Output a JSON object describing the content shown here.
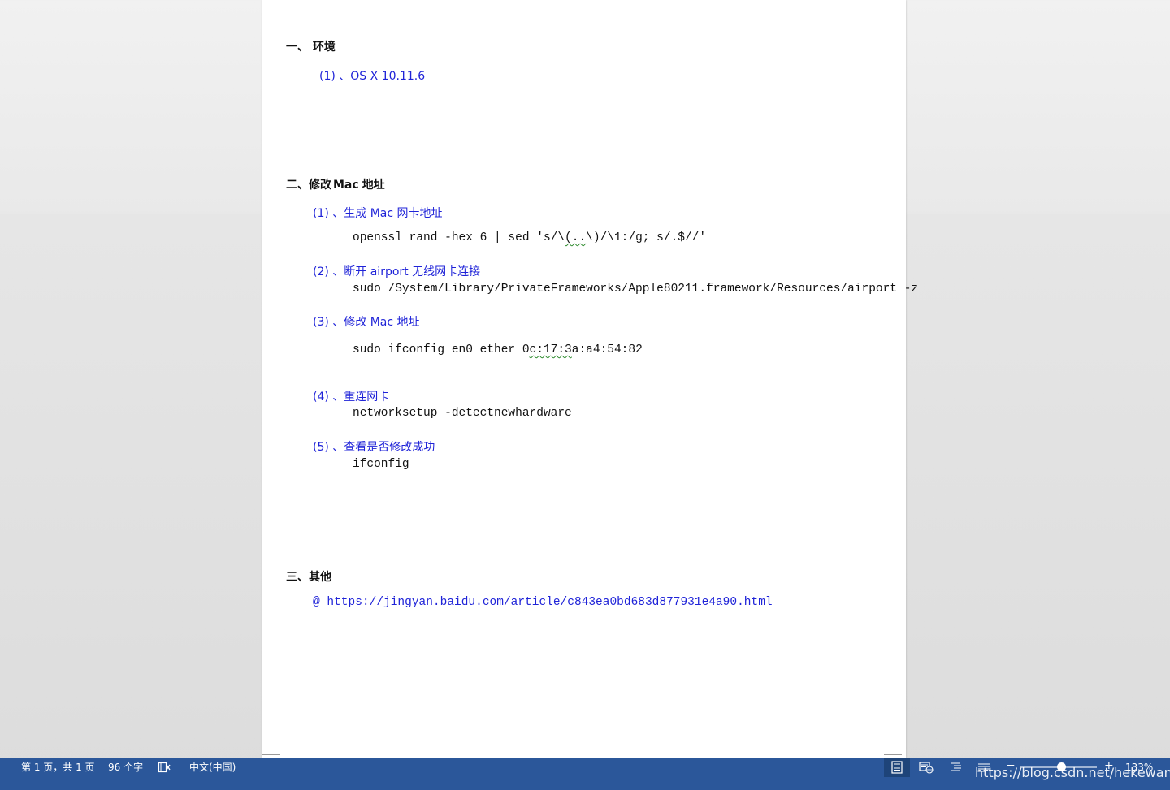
{
  "document": {
    "section1": {
      "heading": "一、 环境",
      "item1": "(1) 、OS X 10.11.6"
    },
    "section2": {
      "heading_prefix": "二、修改",
      "heading_mac": "Mac",
      "heading_suffix": "地址",
      "step1_title": "(1) 、生成 Mac 网卡地址",
      "step1_cmd_a": "openssl rand -hex 6 | sed 's/\\",
      "step1_cmd_sq": "(..",
      "step1_cmd_b": "\\)/\\1:/g; s/.$//'",
      "step2_title": "(2) 、断开 airport 无线网卡连接",
      "step2_cmd": "sudo /System/Library/PrivateFrameworks/Apple80211.framework/Resources/airport -z",
      "step3_title": "(3) 、修改 Mac 地址",
      "step3_cmd_a": "sudo ifconfig en0 ether 0",
      "step3_cmd_sq": "c:17:3",
      "step3_cmd_b": "a:a4:54:82",
      "step4_title": "(4) 、重连网卡",
      "step4_cmd": "networksetup -detectnewhardware",
      "step5_title": "(5) 、查看是否修改成功",
      "step5_cmd": "ifconfig"
    },
    "section3": {
      "heading": "三、其他",
      "link": "@ https://jingyan.baidu.com/article/c843ea0bd683d877931e4a90.html"
    }
  },
  "statusbar": {
    "page_info": "第 1 页，共 1 页",
    "word_count": "96 个字",
    "proofing_icon": "proofing-book-icon",
    "language": "中文(中国)",
    "zoom": "133%",
    "zoom_minus": "−",
    "zoom_plus": "+"
  },
  "watermark": "https://blog.csdn.net/hekewangzi",
  "colors": {
    "statusbar_bg": "#2b579a",
    "heading_blue": "#1f23d8",
    "spell_squiggle": "#2c8a2c"
  }
}
